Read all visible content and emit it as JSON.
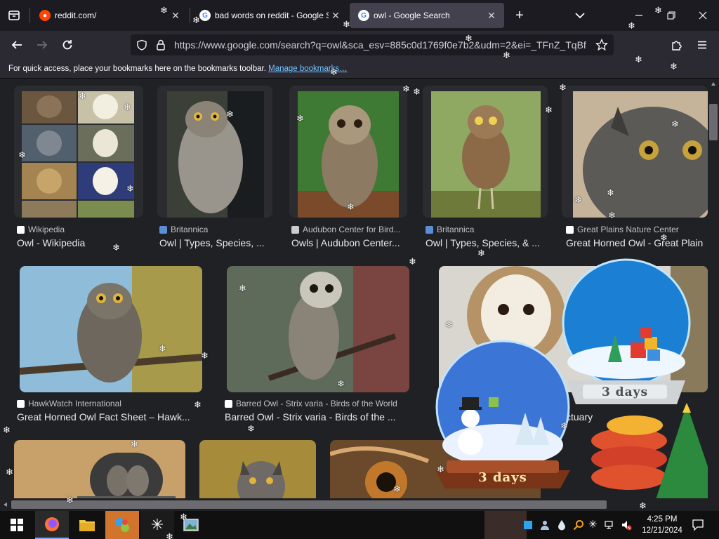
{
  "browser": {
    "tabs": [
      {
        "title": "reddit.com/",
        "favicon": "reddit-icon",
        "active": false
      },
      {
        "title": "bad words on reddit - Google S",
        "favicon": "google-icon",
        "active": false
      },
      {
        "title": "owl - Google Search",
        "favicon": "google-icon",
        "active": true
      }
    ],
    "url": "https://www.google.com/search?q=owl&sca_esv=885c0d1769f0e7b2&udm=2&ei=_TFnZ_TqBf",
    "bookmarks_message": "For quick access, place your bookmarks here on the bookmarks toolbar.",
    "bookmarks_link": "Manage bookmarks…"
  },
  "results": {
    "row1": [
      {
        "source": "Wikipedia",
        "title": "Owl - Wikipedia"
      },
      {
        "source": "Britannica",
        "title": "Owl | Types, Species, ..."
      },
      {
        "source": "Audubon Center for Bird...",
        "title": "Owls | Audubon Center..."
      },
      {
        "source": "Britannica",
        "title": "Owl | Types, Species, & ..."
      },
      {
        "source": "Great Plains Nature Center",
        "title": "Great Horned Owl - Great Plain"
      }
    ],
    "row2": [
      {
        "source": "HawkWatch International",
        "title": "Great Horned Owl Fact Sheet – Hawk..."
      },
      {
        "source": "Barred Owl - Strix varia - Birds of the World",
        "title": "Barred Owl - Strix varia - Birds of the ..."
      },
      {
        "title": "ctuary"
      }
    ]
  },
  "overlay": {
    "globe_small_label": "3 days",
    "globe_large_label": "3 days"
  },
  "taskbar": {
    "time": "4:25 PM",
    "date": "12/21/2024"
  },
  "colors": {
    "tabstrip": "#1c1b22",
    "navbar": "#2b2a33",
    "content_bg": "#202124",
    "link": "#73c3ff"
  }
}
